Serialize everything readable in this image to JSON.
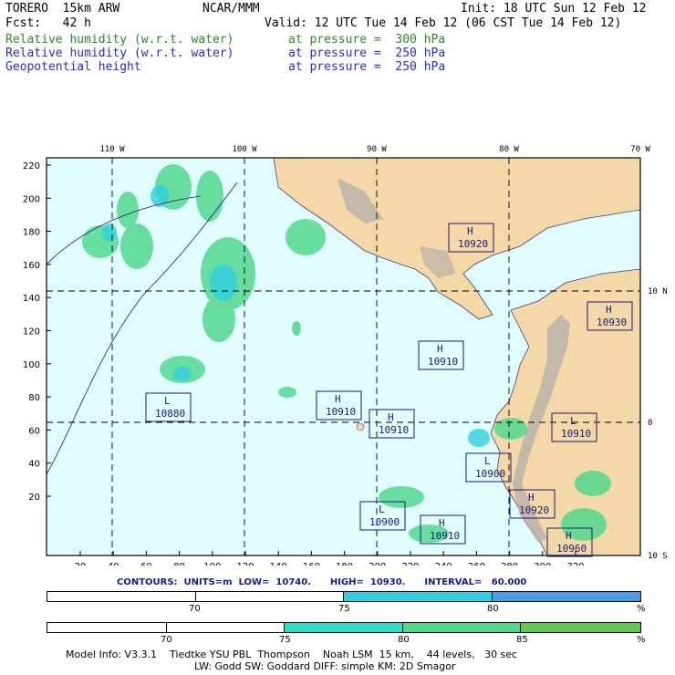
{
  "header": {
    "model": "TORERO  15km ARW",
    "center": "NCAR/MMM",
    "init": "Init: 18 UTC Sun 12 Feb 12",
    "fcst": "Fcst:   42 h",
    "valid": "Valid: 12 UTC Tue 14 Feb 12 (06 CST Tue 14 Feb 12)",
    "fields": [
      {
        "name": "Relative humidity (w.r.t. water)",
        "level": "at pressure =  300 hPa",
        "color": "#2a8a2a"
      },
      {
        "name": "Relative humidity (w.r.t. water)",
        "level": "at pressure =  250 hPa",
        "color": "#2a2acf"
      },
      {
        "name": "Geopotential height",
        "level": "at pressure =  250 hPa",
        "color": "#2a2acf"
      }
    ]
  },
  "map": {
    "lon_labels": [
      "110 W",
      "100 W",
      "90 W",
      "80 W",
      "70 W"
    ],
    "lat_labels": [
      "10 N",
      "0",
      "10 S"
    ],
    "y_ticks": [
      "220",
      "200",
      "180",
      "160",
      "140",
      "120",
      "100",
      "80",
      "60",
      "40",
      "20"
    ],
    "x_ticks": [
      "20",
      "40",
      "60",
      "80",
      "100",
      "120",
      "140",
      "160",
      "180",
      "200",
      "220",
      "240",
      "260",
      "280",
      "300",
      "320"
    ],
    "centers": [
      {
        "type": "H",
        "value": "10920"
      },
      {
        "type": "H",
        "value": "10930"
      },
      {
        "type": "H",
        "value": "10910"
      },
      {
        "type": "L",
        "value": "10880"
      },
      {
        "type": "H",
        "value": "10910"
      },
      {
        "type": "H",
        "value": "10910"
      },
      {
        "type": "L",
        "value": "10910"
      },
      {
        "type": "L",
        "value": "10900"
      },
      {
        "type": "H",
        "value": "10920"
      },
      {
        "type": "L",
        "value": "10900"
      },
      {
        "type": "H",
        "value": "10910"
      },
      {
        "type": "H",
        "value": "10960"
      }
    ]
  },
  "contours": {
    "label": "CONTOURS:  UNITS=m  LOW=  10740.      HIGH=  10930.      INTERVAL=   60.000"
  },
  "legend_250": {
    "ticks": [
      "70",
      "75",
      "80",
      "%"
    ],
    "colors": [
      "#ffffff",
      "#ffffff",
      "#2fd0e0",
      "#4a9ee8"
    ]
  },
  "legend_300": {
    "ticks": [
      "70",
      "75",
      "80",
      "85",
      "%"
    ],
    "colors": [
      "#ffffff",
      "#ffffff",
      "#2ee0c8",
      "#52d890",
      "#60c850"
    ]
  },
  "model_info": {
    "line1": "Model Info: V3.3.1    Tiedtke YSU PBL  Thompson    Noah LSM  15 km,    44 levels,   30 sec",
    "line2": "LW: Godd SW: Goddard DIFF: simple KM: 2D Smagor"
  }
}
